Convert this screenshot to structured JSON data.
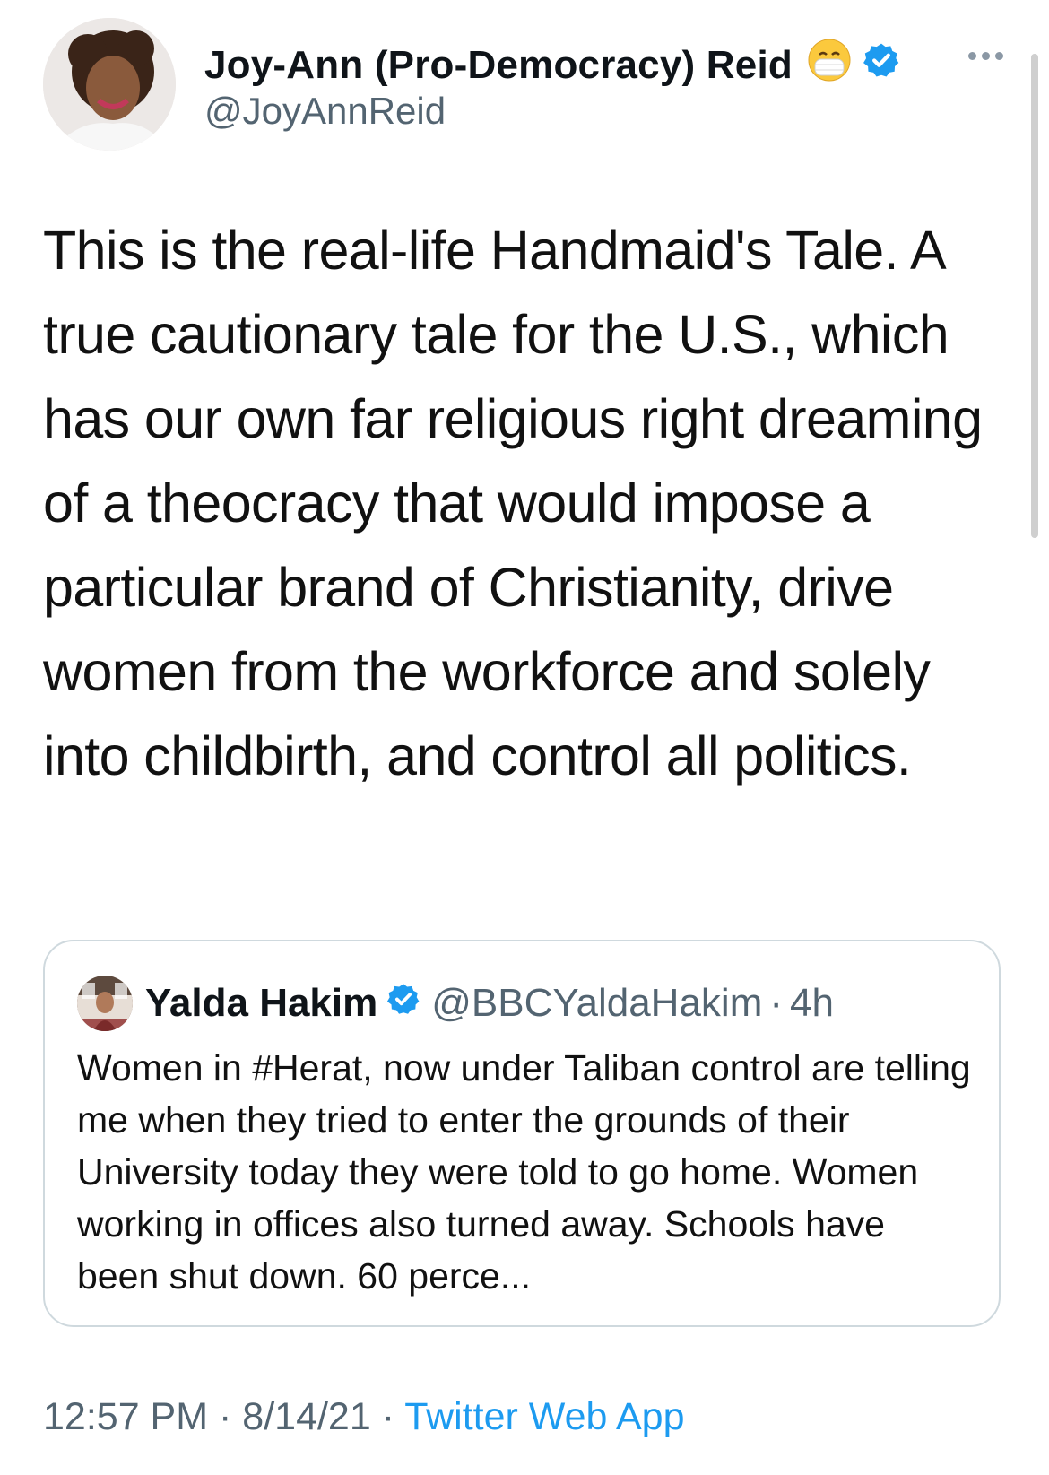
{
  "tweet": {
    "author_name": "Joy-Ann (Pro-Democracy) Reid",
    "author_handle": "@JoyAnnReid",
    "text": "This is the real-life Handmaid's Tale. A true cautionary tale for the U.S., which has our own far religious right dreaming of a theocracy that would impose a particular brand of Christianity, drive women from the workforce and solely into childbirth, and control all politics.",
    "time": "12:57 PM",
    "date": "8/14/21",
    "source": "Twitter Web App",
    "separator": "·"
  },
  "quoted_tweet": {
    "author_name": "Yalda Hakim",
    "author_handle": "@BBCYaldaHakim",
    "age": "4h",
    "separator": "·",
    "text": "Women in #Herat, now under Taliban control are telling me when they tried to enter the grounds of their University today they were told to go home. Women working in offices also turned away. Schools have been shut down. 60 perce..."
  },
  "icons": {
    "verified": "verified-badge-icon",
    "emoji": "face-with-medical-mask-icon",
    "more": "more-options-icon"
  },
  "colors": {
    "verified_blue": "#1d9bf0",
    "secondary_text": "#536471",
    "link": "#1d9bf0",
    "border": "#cfd9de"
  }
}
